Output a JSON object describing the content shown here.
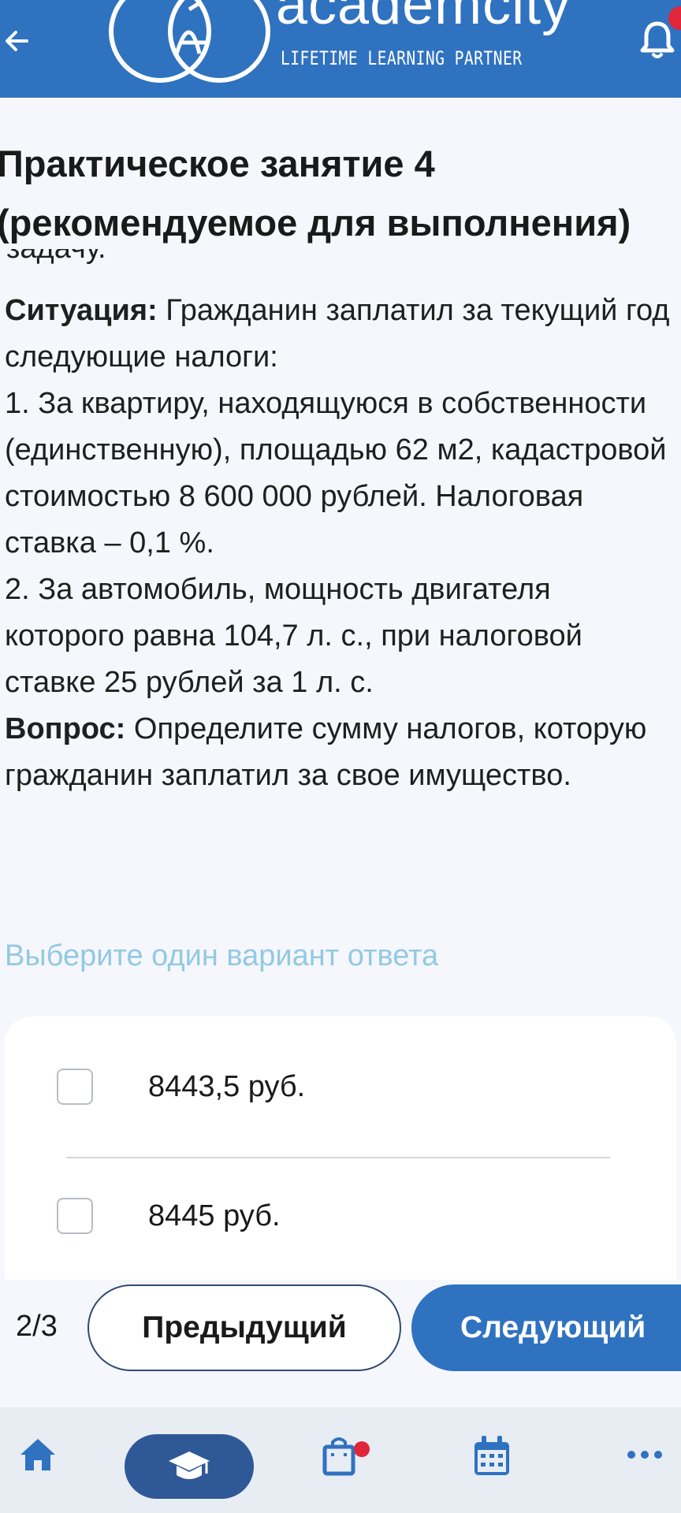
{
  "header": {
    "brand_name": "academcity",
    "brand_tagline": "LIFETIME LEARNING PARTNER",
    "back_icon": "arrow-left-icon",
    "notification_icon": "bell-icon",
    "colors": {
      "bar": "#2f72c0",
      "badge": "#e0263a"
    }
  },
  "page": {
    "title_line1": "Практическое занятие 4",
    "title_line2": "(рекомендуемое для выполнения)"
  },
  "question": {
    "clipped_top_text": "задачу.",
    "situation_label": "Ситуация:",
    "situation_text": " Гражданин заплатил за текущий год следующие налоги:",
    "item1": "1. За квартиру, находящуюся в собственности (единственную), площадью 62 м2, кадастровой стоимостью 8 600 000 рублей. Налоговая ставка – 0,1 %.",
    "item2": "2. За автомобиль, мощность двигателя которого равна 104,7 л. с., при налоговой ставке 25 рублей за 1 л. с.",
    "question_label": "Вопрос:",
    "question_text": " Определите сумму налогов, которую гражданин заплатил за свое имущество."
  },
  "answers": {
    "hint": "Выберите один вариант ответа",
    "options": [
      {
        "label": "8443,5 руб.",
        "checked": false
      },
      {
        "label": "8445 руб.",
        "checked": false
      }
    ]
  },
  "navigation": {
    "counter": "2/3",
    "prev_label": "Предыдущий",
    "next_label": "Следующий"
  },
  "tab_bar": {
    "tabs": [
      {
        "icon": "home-icon",
        "active": false
      },
      {
        "icon": "graduation-cap-icon",
        "active": true
      },
      {
        "icon": "shopping-bag-icon",
        "active": false,
        "has_badge": true
      },
      {
        "icon": "calendar-icon",
        "active": false
      },
      {
        "icon": "more-icon",
        "active": false
      }
    ]
  }
}
